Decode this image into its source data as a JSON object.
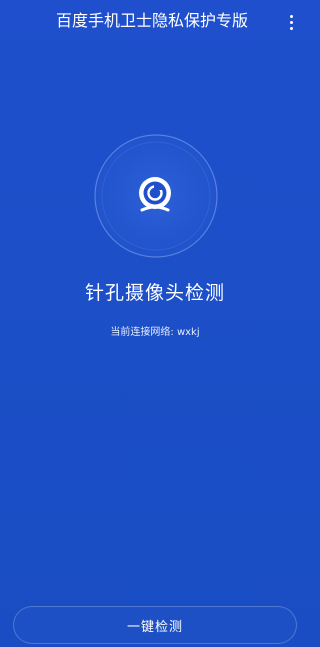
{
  "header": {
    "title": "百度手机卫士隐私保护专版",
    "more_icon": "more-vertical-icon"
  },
  "main": {
    "visual_icon": "pinhole-camera-grid-icon",
    "title": "针孔摄像头检测",
    "network_label": "当前连接网络:",
    "network_name": "wxkj"
  },
  "footer": {
    "detect_button_label": "一键检测"
  },
  "colors": {
    "background": "#1f4fcc",
    "text": "#ffffff"
  }
}
